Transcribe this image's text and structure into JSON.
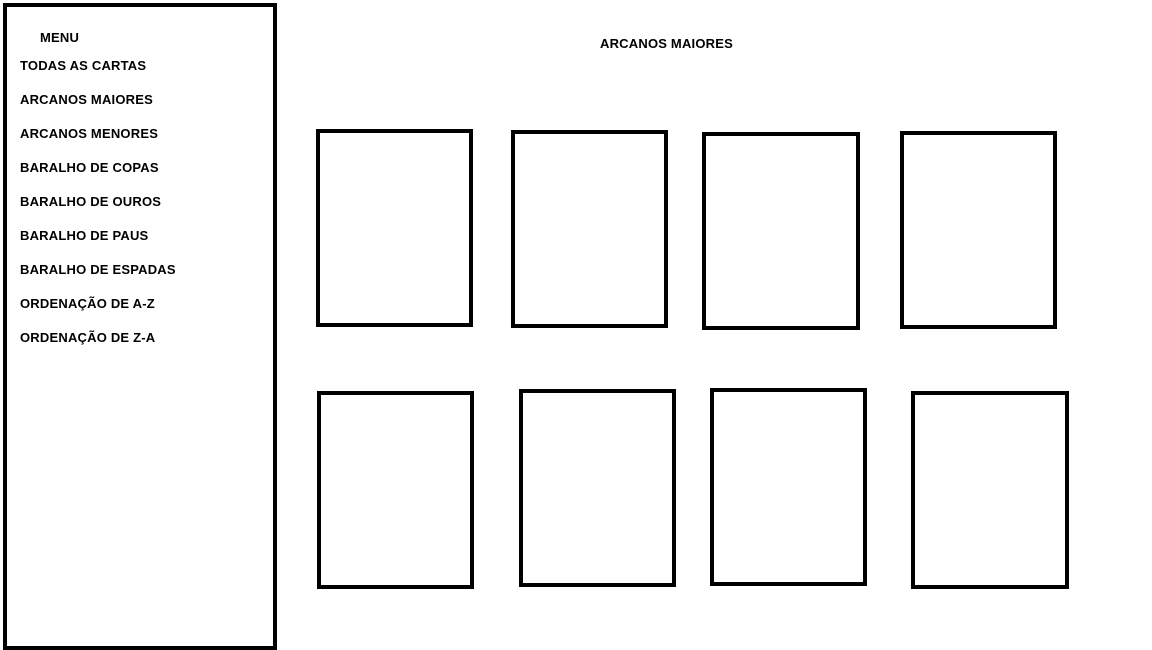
{
  "sidebar": {
    "title": "MENU",
    "items": [
      {
        "label": "TODAS AS CARTAS"
      },
      {
        "label": "ARCANOS MAIORES"
      },
      {
        "label": "ARCANOS MENORES"
      },
      {
        "label": "BARALHO DE COPAS"
      },
      {
        "label": "BARALHO DE OUROS"
      },
      {
        "label": "BARALHO DE PAUS"
      },
      {
        "label": "BARALHO DE ESPADAS"
      },
      {
        "label": "ORDENAÇÃO DE A-Z"
      },
      {
        "label": "ORDENAÇÃO DE Z-A"
      }
    ]
  },
  "main": {
    "title": "ARCANOS MAIORES",
    "card_count": 8
  },
  "colors": {
    "border": "#000000",
    "background": "#ffffff",
    "text": "#000000"
  }
}
